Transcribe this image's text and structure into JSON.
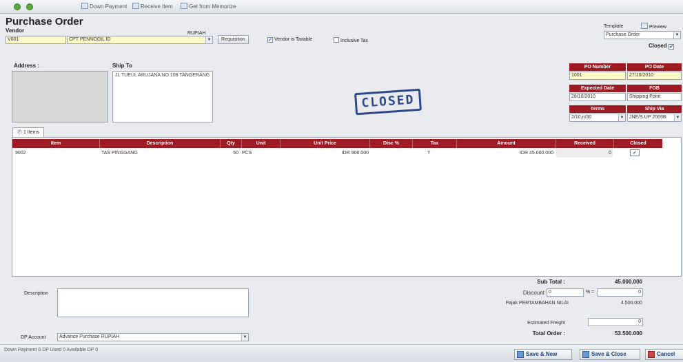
{
  "toolbar": {
    "items": [
      "Down Payment",
      "Receive Item",
      "Get from Memorize"
    ]
  },
  "form": {
    "title": "Purchase Order",
    "vendor_label": "Vendor",
    "vendor_id": "V001",
    "vendor_name": "CPT PENNOOIL ID",
    "currency": "RUPIAH",
    "requisition_button": "Requisition",
    "vendor_taxable_label": "Vendor is Taxable",
    "inclusive_tax_label": "Inclusive Tax",
    "address_label": "Address :",
    "ship_to_label": "Ship To",
    "ship_to_text": "JL TUEUL ARUJANA NO 108 TANGERANG",
    "template_label": "Template",
    "preview_label": "Preview",
    "template_value": "Purchase Order",
    "closed_label": "Closed",
    "closed_stamp": "CLOSED"
  },
  "po_header": {
    "po_number_label": "PO Number",
    "po_date_label": "PO Date",
    "po_number": "1001",
    "po_date": "27/10/2010",
    "expected_date_label": "Expected Date",
    "fob_label": "FOB",
    "expected_date": "28/10/2010",
    "fob_value": "Shipping Point",
    "terms_label": "Terms",
    "ship_via_label": "Ship Via",
    "terms_value": "2/10,n/30",
    "ship_via_value": "JNE/S UP 2009B"
  },
  "items_tab": {
    "label": "Ⓕ 1 Items"
  },
  "grid": {
    "columns": [
      "Item",
      "Description",
      "Qty",
      "Unit",
      "Unit Price",
      "Disc %",
      "Tax",
      "Amount",
      "Received",
      "Closed"
    ],
    "rows": [
      {
        "item": "9002",
        "description": "TAS PINGGANG",
        "qty": "50",
        "unit": "PCS",
        "unit_price": "IDR 900.000",
        "disc": "",
        "tax": "T",
        "amount": "IDR 45.000.000",
        "received": "0",
        "closed": "✔"
      }
    ]
  },
  "footer": {
    "description_label": "Description",
    "dp_account_label": "DP Account",
    "dp_account_value": "Advance Purchase RUPIAH",
    "status_text": "Down Payment 0   DP Used 0   Available DP 0",
    "sub_total_label": "Sub Total :",
    "sub_total": "45.000.000",
    "discount_label": "Discount",
    "discount_percent": "0",
    "discount_amount": "0",
    "tax_label": "Pajak PERTAMBAHAN NILAI",
    "tax_amount": "4.500.000",
    "freight_label": "Estimated Freight",
    "freight_amount": "0",
    "total_label": "Total Order :",
    "total_order": "53.500.000",
    "percent_sign": "% ="
  },
  "actions": {
    "save_new": "Save & New",
    "save_close": "Save & Close",
    "cancel": "Cancel"
  }
}
